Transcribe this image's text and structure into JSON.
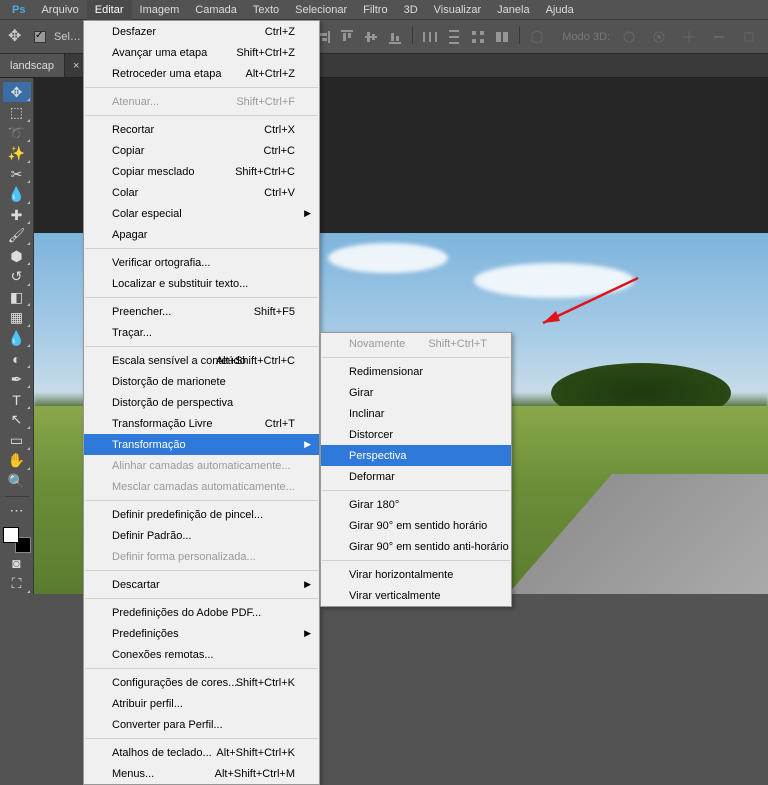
{
  "menubar": {
    "items": [
      "Arquivo",
      "Editar",
      "Imagem",
      "Camada",
      "Texto",
      "Selecionar",
      "Filtro",
      "3D",
      "Visualizar",
      "Janela",
      "Ajuda"
    ],
    "active_index": 1
  },
  "toolbar": {
    "auto_select_label": "Sel…",
    "mode3d_label": "Modo 3D:"
  },
  "tab": {
    "title": "landscap",
    "close": "×"
  },
  "tools": [
    "move",
    "marquee",
    "lasso",
    "wand",
    "crop",
    "eyedrop",
    "heal",
    "brush",
    "stamp",
    "history",
    "eraser",
    "gradient",
    "blur",
    "dodge",
    "pen",
    "type",
    "path",
    "rect",
    "hand",
    "zoom"
  ],
  "edit_menu": [
    {
      "label": "Desfazer",
      "shortcut": "Ctrl+Z"
    },
    {
      "label": "Avançar uma etapa",
      "shortcut": "Shift+Ctrl+Z"
    },
    {
      "label": "Retroceder uma etapa",
      "shortcut": "Alt+Ctrl+Z"
    },
    {
      "sep": true
    },
    {
      "label": "Atenuar...",
      "shortcut": "Shift+Ctrl+F",
      "disabled": true
    },
    {
      "sep": true
    },
    {
      "label": "Recortar",
      "shortcut": "Ctrl+X"
    },
    {
      "label": "Copiar",
      "shortcut": "Ctrl+C"
    },
    {
      "label": "Copiar mesclado",
      "shortcut": "Shift+Ctrl+C"
    },
    {
      "label": "Colar",
      "shortcut": "Ctrl+V"
    },
    {
      "label": "Colar especial",
      "submenu": true
    },
    {
      "label": "Apagar"
    },
    {
      "sep": true
    },
    {
      "label": "Verificar ortografia..."
    },
    {
      "label": "Localizar e substituir texto..."
    },
    {
      "sep": true
    },
    {
      "label": "Preencher...",
      "shortcut": "Shift+F5"
    },
    {
      "label": "Traçar..."
    },
    {
      "sep": true
    },
    {
      "label": "Escala sensível a conteúdo",
      "shortcut": "Alt+Shift+Ctrl+C"
    },
    {
      "label": "Distorção de marionete"
    },
    {
      "label": "Distorção de perspectiva"
    },
    {
      "label": "Transformação Livre",
      "shortcut": "Ctrl+T"
    },
    {
      "label": "Transformação",
      "submenu": true,
      "hl": true
    },
    {
      "label": "Alinhar camadas automaticamente...",
      "disabled": true
    },
    {
      "label": "Mesclar camadas automaticamente...",
      "disabled": true
    },
    {
      "sep": true
    },
    {
      "label": "Definir predefinição de pincel..."
    },
    {
      "label": "Definir Padrão..."
    },
    {
      "label": "Definir forma personalizada...",
      "disabled": true
    },
    {
      "sep": true
    },
    {
      "label": "Descartar",
      "submenu": true
    },
    {
      "sep": true
    },
    {
      "label": "Predefinições do Adobe PDF..."
    },
    {
      "label": "Predefinições",
      "submenu": true
    },
    {
      "label": "Conexões remotas..."
    },
    {
      "sep": true
    },
    {
      "label": "Configurações de cores...",
      "shortcut": "Shift+Ctrl+K"
    },
    {
      "label": "Atribuir perfil..."
    },
    {
      "label": "Converter para Perfil..."
    },
    {
      "sep": true
    },
    {
      "label": "Atalhos de teclado...",
      "shortcut": "Alt+Shift+Ctrl+K"
    },
    {
      "label": "Menus...",
      "shortcut": "Alt+Shift+Ctrl+M"
    }
  ],
  "transform_menu": [
    {
      "label": "Novamente",
      "shortcut": "Shift+Ctrl+T",
      "disabled": true
    },
    {
      "sep": true
    },
    {
      "label": "Redimensionar"
    },
    {
      "label": "Girar"
    },
    {
      "label": "Inclinar"
    },
    {
      "label": "Distorcer"
    },
    {
      "label": "Perspectiva",
      "hl": true
    },
    {
      "label": "Deformar"
    },
    {
      "sep": true
    },
    {
      "label": "Girar 180°"
    },
    {
      "label": "Girar 90° em sentido horário"
    },
    {
      "label": "Girar 90° em sentido anti-horário"
    },
    {
      "sep": true
    },
    {
      "label": "Virar horizontalmente"
    },
    {
      "label": "Virar verticalmente"
    }
  ]
}
